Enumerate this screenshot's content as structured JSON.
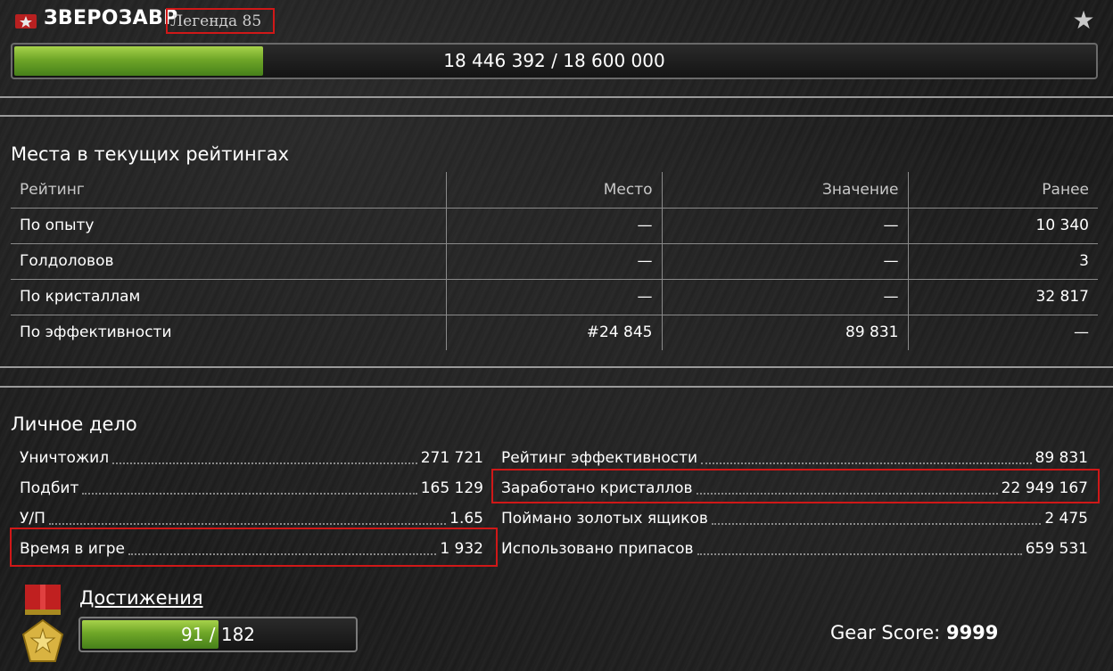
{
  "header": {
    "player_name": "ЗВЕРОЗАВР",
    "rank_title": "Легенда 85",
    "rank_icon": "rank-insignia-icon",
    "favorite_icon": "star-icon"
  },
  "experience": {
    "text": "18 446 392 / 18 600 000",
    "fill_fraction": 0.2306
  },
  "ratings": {
    "title": "Места в текущих рейтингах",
    "columns": [
      "Рейтинг",
      "Место",
      "Значение",
      "Ранее"
    ],
    "rows": [
      [
        "По опыту",
        "—",
        "—",
        "10 340"
      ],
      [
        "Голдоловов",
        "—",
        "—",
        "3"
      ],
      [
        "По кристаллам",
        "—",
        "—",
        "32 817"
      ],
      [
        "По эффективности",
        "#24 845",
        "89 831",
        "—"
      ]
    ]
  },
  "personal": {
    "title": "Личное дело",
    "left": [
      {
        "label": "Уничтожил",
        "value": "271 721"
      },
      {
        "label": "Подбит",
        "value": "165 129"
      },
      {
        "label": "У/П",
        "value": "1.65"
      },
      {
        "label": "Время в игре",
        "value": "1 932"
      }
    ],
    "right": [
      {
        "label": "Рейтинг эффективности",
        "value": "89 831"
      },
      {
        "label": "Заработано кристаллов",
        "value": "22 949 167"
      },
      {
        "label": "Поймано золотых ящиков",
        "value": "2 475"
      },
      {
        "label": "Использовано припасов",
        "value": "659 531"
      }
    ]
  },
  "achievements": {
    "title": "Достижения",
    "current": "91",
    "separator": "/",
    "total": "182",
    "fill_fraction": 0.5,
    "icon": "medal-icon"
  },
  "gear": {
    "label": "Gear Score:",
    "value": "9999"
  },
  "colors": {
    "highlight": "#d01818",
    "progress_green": "#6fa628"
  }
}
